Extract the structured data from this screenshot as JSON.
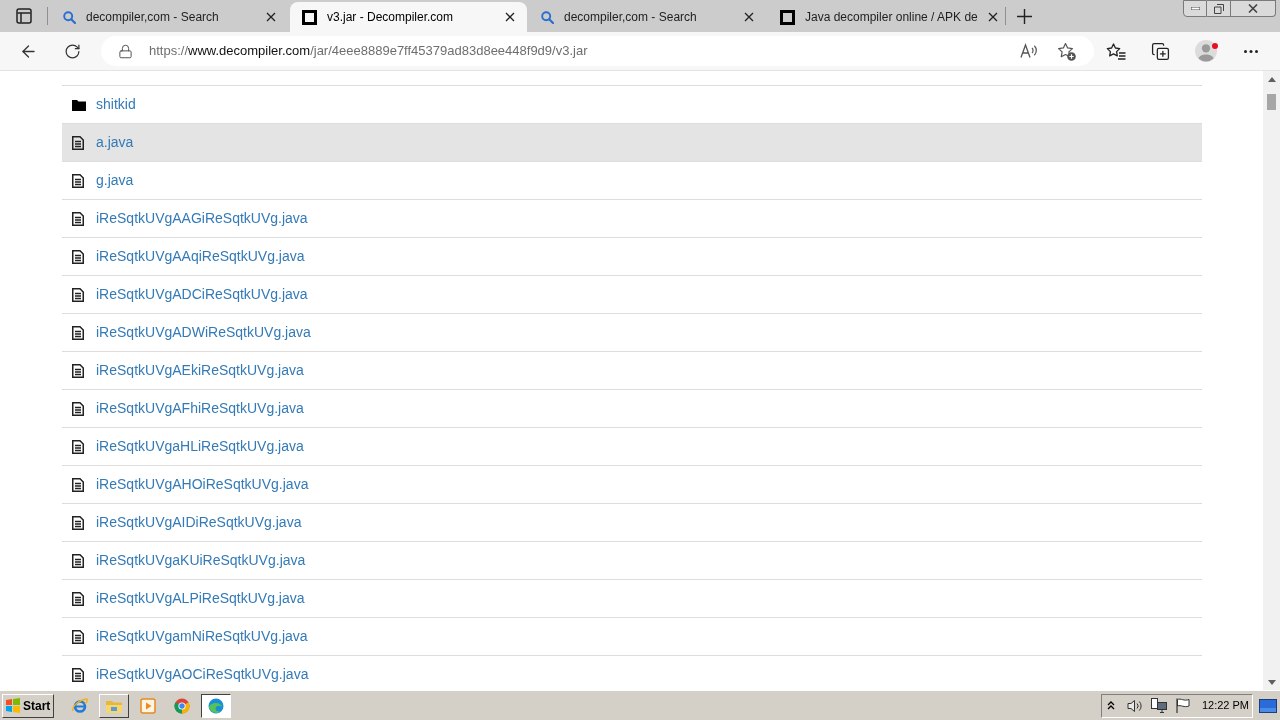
{
  "tabs": [
    {
      "title": "decompiler,com - Search",
      "kind": "search",
      "selected": false
    },
    {
      "title": "v3.jar - Decompiler.com",
      "kind": "site",
      "selected": true
    },
    {
      "title": "decompiler,com - Search",
      "kind": "search",
      "selected": false
    },
    {
      "title": "Java decompiler online / APK de",
      "kind": "site",
      "selected": false
    }
  ],
  "address_bar": {
    "scheme": "https://",
    "host": "www.decompiler.com",
    "path": "/jar/4eee8889e7ff45379ad83d8ee448f9d9/v3.jar"
  },
  "profile": {
    "notification": true
  },
  "files": [
    {
      "name": "shitkid",
      "kind": "folder",
      "hovered": false
    },
    {
      "name": "a.java",
      "kind": "file",
      "hovered": true
    },
    {
      "name": "g.java",
      "kind": "file",
      "hovered": false
    },
    {
      "name": "iReSqtkUVgAAGiReSqtkUVg.java",
      "kind": "file",
      "hovered": false
    },
    {
      "name": "iReSqtkUVgAAqiReSqtkUVg.java",
      "kind": "file",
      "hovered": false
    },
    {
      "name": "iReSqtkUVgADCiReSqtkUVg.java",
      "kind": "file",
      "hovered": false
    },
    {
      "name": "iReSqtkUVgADWiReSqtkUVg.java",
      "kind": "file",
      "hovered": false
    },
    {
      "name": "iReSqtkUVgAEkiReSqtkUVg.java",
      "kind": "file",
      "hovered": false
    },
    {
      "name": "iReSqtkUVgAFhiReSqtkUVg.java",
      "kind": "file",
      "hovered": false
    },
    {
      "name": "iReSqtkUVgaHLiReSqtkUVg.java",
      "kind": "file",
      "hovered": false
    },
    {
      "name": "iReSqtkUVgAHOiReSqtkUVg.java",
      "kind": "file",
      "hovered": false
    },
    {
      "name": "iReSqtkUVgAIDiReSqtkUVg.java",
      "kind": "file",
      "hovered": false
    },
    {
      "name": "iReSqtkUVgaKUiReSqtkUVg.java",
      "kind": "file",
      "hovered": false
    },
    {
      "name": "iReSqtkUVgALPiReSqtkUVg.java",
      "kind": "file",
      "hovered": false
    },
    {
      "name": "iReSqtkUVgamNiReSqtkUVg.java",
      "kind": "file",
      "hovered": false
    },
    {
      "name": "iReSqtkUVgAOCiReSqtkUVg.java",
      "kind": "file",
      "hovered": false
    }
  ],
  "taskbar": {
    "start_label": "Start",
    "apps": [
      {
        "kind": "ie",
        "open": false,
        "selected": false
      },
      {
        "kind": "explorer",
        "open": true,
        "selected": false
      },
      {
        "kind": "media",
        "open": false,
        "selected": false
      },
      {
        "kind": "chrome",
        "open": false,
        "selected": false
      },
      {
        "kind": "edge",
        "open": true,
        "selected": true
      }
    ],
    "clock": "12:22 PM"
  }
}
